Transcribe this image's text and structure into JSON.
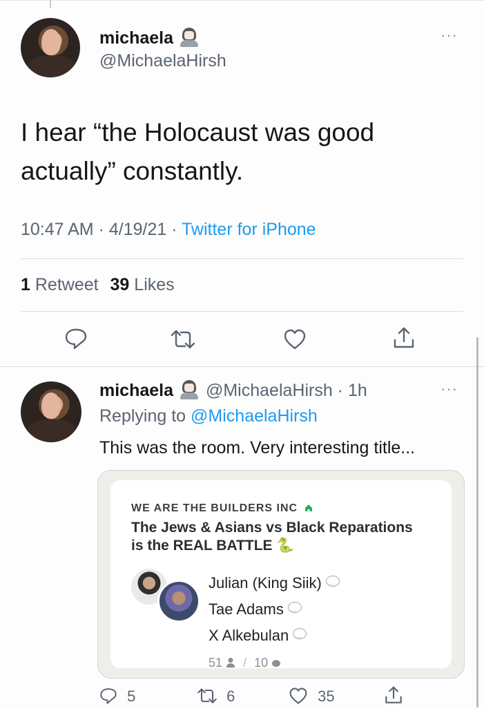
{
  "tweet": {
    "display_name": "michaela",
    "handle": "@MichaelaHirsh",
    "body_line1": "I hear “the Holocaust was good",
    "body_line2": "actually” constantly.",
    "time": "10:47 AM · 4/19/21 · ",
    "source": "Twitter for iPhone",
    "retweets": "1",
    "retweets_label": "Retweet",
    "likes": "39",
    "likes_label": "Likes",
    "more": "···"
  },
  "reply": {
    "display_name": "michaela",
    "handle": "@MichaelaHirsh",
    "age": " · 1h",
    "replying_prefix": "Replying to ",
    "replying_handle": "@MichaelaHirsh",
    "text": "This was the room. Very interesting title...",
    "more": "···",
    "counts": {
      "replies": "5",
      "retweets": "6",
      "likes": "35"
    }
  },
  "room_card": {
    "club": "WE ARE THE BUILDERS INC",
    "title_line1": "The Jews & Asians vs Black Reparations",
    "title_line2": "is the REAL BATTLE",
    "title_emoji": "🐍",
    "speakers": [
      "Julian (King Siik)",
      "Tae Adams",
      "X Alkebulan"
    ],
    "listeners": "51",
    "speakers_count": "10",
    "slash": "/"
  },
  "colors": {
    "link": "#1d9bf0",
    "secondary": "#5b6470",
    "club_icon": "#27ae60"
  },
  "icons": [
    "more-icon",
    "reply-icon",
    "retweet-icon",
    "like-icon",
    "share-icon",
    "home-icon",
    "person-icon",
    "chat-icon"
  ]
}
